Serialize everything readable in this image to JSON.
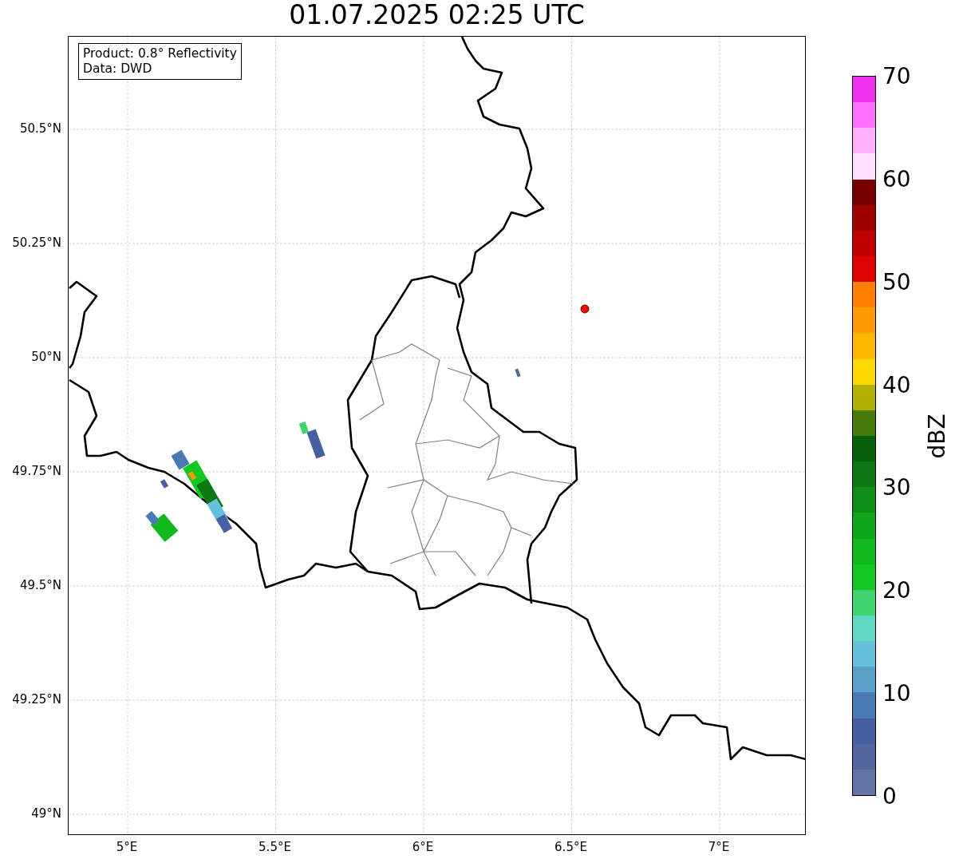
{
  "title": "01.07.2025 02:25 UTC",
  "info_box": {
    "lines": [
      "Product: 0.8° Reflectivity",
      "Data: DWD"
    ]
  },
  "map": {
    "lat_ticks": [
      "50.5°N",
      "50.25°N",
      "50°N",
      "49.75°N",
      "49.5°N",
      "49.25°N",
      "49°N"
    ],
    "lon_ticks": [
      "5°E",
      "5.5°E",
      "6°E",
      "6.5°E",
      "7°E"
    ]
  },
  "colorbar": {
    "label": "dBZ",
    "ticks": [
      "70",
      "60",
      "50",
      "40",
      "30",
      "20",
      "10",
      "0"
    ],
    "bands": [
      {
        "color": "#ee30ee"
      },
      {
        "color": "#ff70ff"
      },
      {
        "color": "#ffb0ff"
      },
      {
        "color": "#ffe0ff"
      },
      {
        "color": "#780000"
      },
      {
        "color": "#a00000"
      },
      {
        "color": "#c00000"
      },
      {
        "color": "#e00000"
      },
      {
        "color": "#ff7f00"
      },
      {
        "color": "#ff9a00"
      },
      {
        "color": "#ffb800"
      },
      {
        "color": "#ffd900"
      },
      {
        "color": "#b0b000"
      },
      {
        "color": "#477a0b"
      },
      {
        "color": "#075e0d"
      },
      {
        "color": "#0b7813"
      },
      {
        "color": "#0d8f15"
      },
      {
        "color": "#0fa719"
      },
      {
        "color": "#10b91c"
      },
      {
        "color": "#13c823"
      },
      {
        "color": "#3ed46e"
      },
      {
        "color": "#60d8c4"
      },
      {
        "color": "#66c2dc"
      },
      {
        "color": "#5ba0c8"
      },
      {
        "color": "#4a7ab3"
      },
      {
        "color": "#4660a2"
      },
      {
        "color": "#53669e"
      },
      {
        "color": "#6473a6"
      }
    ]
  }
}
